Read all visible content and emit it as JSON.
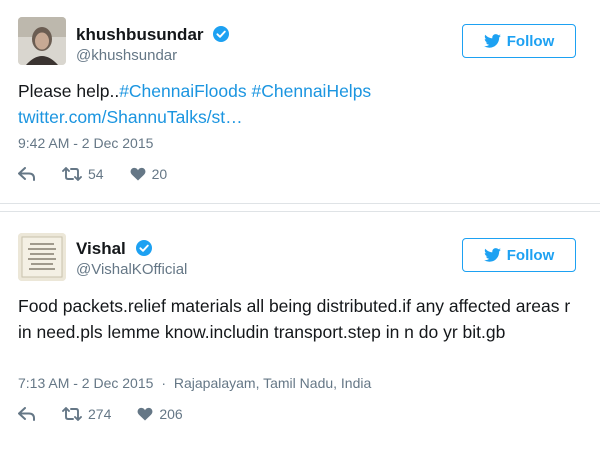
{
  "tweets": [
    {
      "display_name": "khushbusundar",
      "handle": "@khushsundar",
      "follow_label": "Follow",
      "text_prefix": "Please help..",
      "hashtag_1": "#ChennaiFloods",
      "hashtag_2": "#ChennaiHelps",
      "link": "twitter.com/ShannuTalks/st…",
      "timestamp": "9:42 AM - 2 Dec 2015",
      "location": "",
      "retweets": "54",
      "likes": "20"
    },
    {
      "display_name": "Vishal",
      "handle": "@VishalKOfficial",
      "follow_label": "Follow",
      "text": "Food packets.relief materials all being distributed.if any affected areas r in need.pls lemme know.includin transport.step in n do yr bit.gb",
      "timestamp": "7:13 AM - 2 Dec 2015",
      "location": "Rajapalayam, Tamil Nadu, India",
      "separator": "·",
      "retweets": "274",
      "likes": "206"
    }
  ],
  "colors": {
    "accent": "#1da1f2",
    "link": "#1b95e0",
    "muted": "#657786",
    "text": "#14171a"
  },
  "icons": [
    "verified-badge-icon",
    "twitter-bird-icon",
    "reply-icon",
    "retweet-icon",
    "heart-icon"
  ]
}
